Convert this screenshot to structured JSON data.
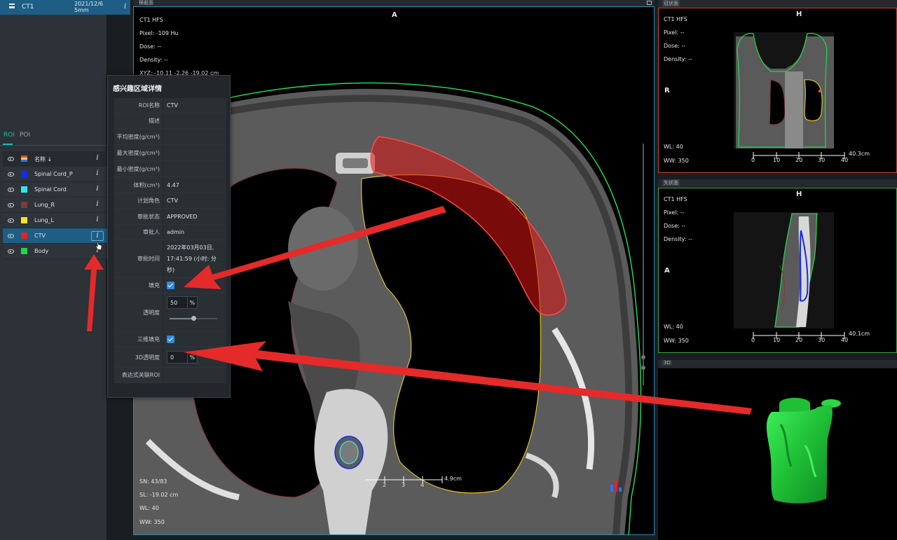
{
  "series_tab": {
    "name": "CT1",
    "date": "2021/12/6",
    "thickness": "5mm",
    "info_label": "i"
  },
  "roi_panel": {
    "tabs": [
      {
        "label": "ROI",
        "active": true
      },
      {
        "label": "POI",
        "active": false
      }
    ],
    "header": {
      "name_label": "名称",
      "sort_icon": "arrow-down",
      "info_label": "i"
    },
    "items": [
      {
        "name": "Spinal Cord_P",
        "color": "#1428f5",
        "selected": false
      },
      {
        "name": "Spinal Cord",
        "color": "#2ee6f0",
        "selected": false
      },
      {
        "name": "Lung_R",
        "color": "#7a3c3c",
        "selected": false
      },
      {
        "name": "Lung_L",
        "color": "#ffe11a",
        "selected": false
      },
      {
        "name": "CTV",
        "color": "#e82020",
        "selected": true
      },
      {
        "name": "Body",
        "color": "#22d54a",
        "selected": false
      }
    ]
  },
  "axial_view": {
    "title": "横截面",
    "orientation_top": "A",
    "series": "CT1 HFS",
    "pixel_label": "Pixel:",
    "pixel_value": "-109 Hu",
    "dose_label": "Dose:",
    "dose_value": "--",
    "density_label": "Density:",
    "density_value": "--",
    "xyz_label": "XYZ:",
    "xyz_value": "-10.11 -2.26 -19.02 cm",
    "sn_label": "SN:",
    "sn_value": "43/83",
    "sl_label": "SL:",
    "sl_value": "-19.02 cm",
    "wl_label": "WL:",
    "wl_value": "40",
    "ww_label": "WW:",
    "ww_value": "350",
    "scale_ticks": [
      "2",
      "3",
      "4"
    ],
    "scale_label": "4.9cm"
  },
  "roi_popup": {
    "title": "感兴趣区域详情",
    "rows": [
      {
        "label": "ROI名称",
        "value": "CTV"
      },
      {
        "label": "描述",
        "value": ""
      },
      {
        "label": "平均密度(g/cm³)",
        "value": ""
      },
      {
        "label": "最大密度(g/cm³)",
        "value": ""
      },
      {
        "label": "最小密度(g/cm³)",
        "value": ""
      },
      {
        "label": "体积(cm³)",
        "value": "4.47"
      },
      {
        "label": "计划角色",
        "value": "CTV"
      },
      {
        "label": "审批状态",
        "value": "APPROVED"
      },
      {
        "label": "审批人",
        "value": "admin"
      },
      {
        "label": "审批时间",
        "value": "2022年03月03日, 17:41:59 (小时: 分秒)"
      }
    ],
    "fill_label": "填充",
    "fill_checked": true,
    "opacity_label": "透明度",
    "opacity_value": "50",
    "opacity_unit": "%",
    "opacity_fraction": 0.5,
    "fill3d_label": "三维填充",
    "fill3d_checked": true,
    "opacity3d_label": "3D透明度",
    "opacity3d_value": "0",
    "opacity3d_unit": "%",
    "expr_label": "表达式关联ROI",
    "expr_value": ""
  },
  "coronal_view": {
    "title": "冠状面",
    "orientation_top": "H",
    "orientation_left": "R",
    "series": "CT1 HFS",
    "pixel_label": "Pixel:",
    "pixel_value": "--",
    "dose_label": "Dose:",
    "dose_value": "--",
    "density_label": "Density:",
    "density_value": "--",
    "wl_label": "WL:",
    "wl_value": "40",
    "ww_label": "WW:",
    "ww_value": "350",
    "scale_ticks": [
      "0",
      "10",
      "20",
      "30",
      "40"
    ],
    "scale_label": "40.3cm"
  },
  "sagittal_view": {
    "title": "矢状面",
    "orientation_top": "H",
    "orientation_left": "A",
    "series": "CT1 HFS",
    "pixel_label": "Pixel:",
    "pixel_value": "--",
    "dose_label": "Dose:",
    "dose_value": "--",
    "density_label": "Density:",
    "density_value": "--",
    "wl_label": "WL:",
    "wl_value": "40",
    "ww_label": "WW:",
    "ww_value": "350",
    "scale_ticks": [
      "0",
      "10",
      "20",
      "30",
      "40"
    ],
    "scale_label": "40.1cm"
  },
  "view_3d": {
    "title": "3D"
  },
  "colors": {
    "accent": "#1e5d84",
    "ctv": "#e82020",
    "body": "#22d54a",
    "lung_l": "#ffe11a",
    "lung_r": "#7a3c3c",
    "annotation": "#e52a2a"
  }
}
